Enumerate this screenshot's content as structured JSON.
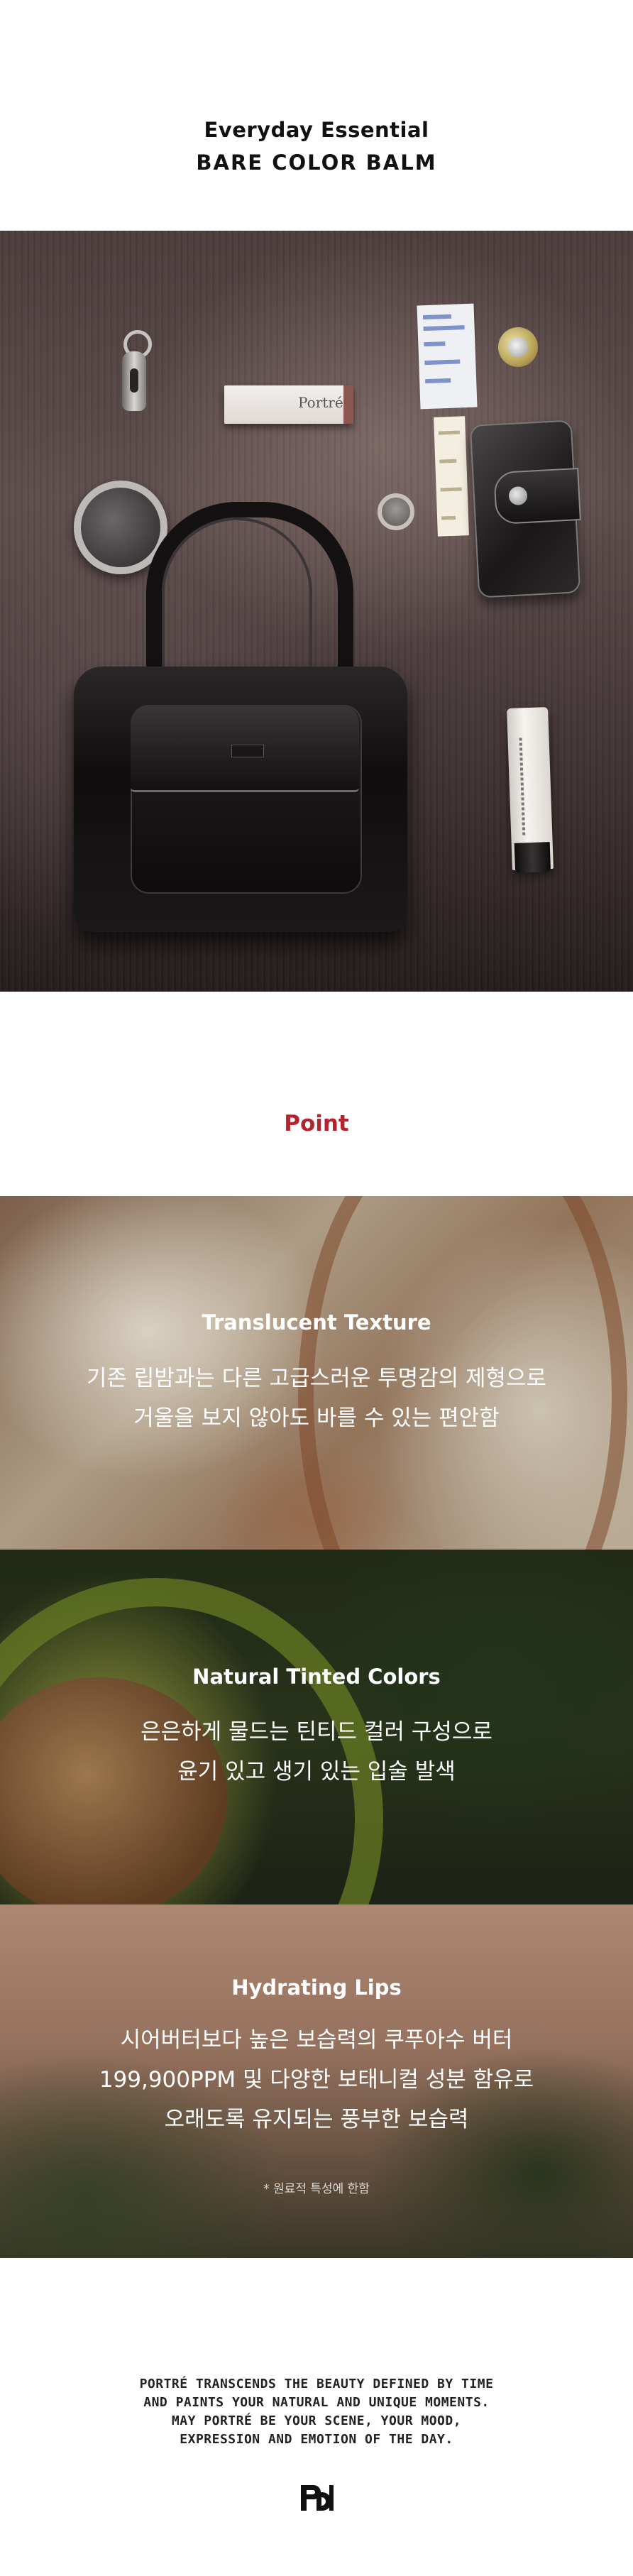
{
  "header": {
    "line1": "Everyday Essential",
    "line2": "BARE COLOR BALM"
  },
  "hero": {
    "description": "",
    "box_brand": "Portré"
  },
  "point": {
    "title": "Point",
    "title_color": "#b3242c"
  },
  "features": [
    {
      "title": "Translucent Texture",
      "lines": [
        "기존 립밤과는 다른 고급스러운 투명감의 제형으로",
        "거울을 보지 않아도 바를 수 있는 편안함"
      ]
    },
    {
      "title": "Natural Tinted Colors",
      "lines": [
        "은은하게 물드는 틴티드 컬러 구성으로",
        "윤기 있고 생기 있는 입술 발색"
      ]
    },
    {
      "title": "Hydrating Lips",
      "lines": [
        "시어버터보다 높은 보습력의 쿠푸아수 버터",
        "199,900PPM 및 다양한 보태니컬 성분 함유로",
        "오래도록 유지되는 풍부한 보습력"
      ],
      "note": "* 원료적 특성에 한함"
    }
  ],
  "footer": {
    "lines": [
      "PORTRÉ TRANSCENDS THE BEAUTY DEFINED BY TIME",
      "AND PAINTS YOUR NATURAL AND UNIQUE MOMENTS.",
      "MAY PORTRÉ BE YOUR SCENE, YOUR MOOD,",
      "EXPRESSION AND EMOTION OF THE DAY."
    ],
    "logo_icon": "pd-monogram-logo"
  }
}
